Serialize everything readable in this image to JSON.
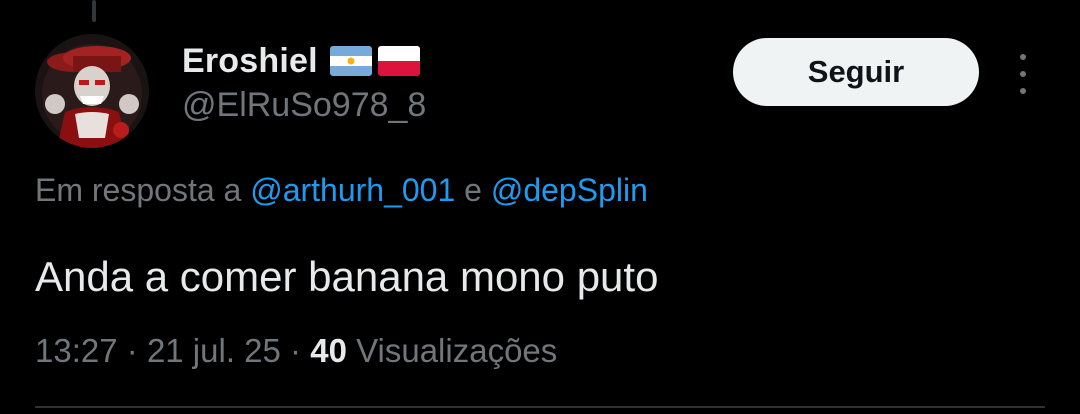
{
  "user": {
    "display_name": "Eroshiel",
    "handle": "@ElRuSo978_8",
    "flags": [
      "argentina-flag",
      "poland-flag"
    ]
  },
  "follow_button": {
    "label": "Seguir"
  },
  "reply_context": {
    "prefix": "Em resposta a",
    "mention_1": "@arthurh_001",
    "conjunction": "e",
    "mention_2": "@depSplin"
  },
  "tweet": {
    "text": "Anda a comer banana mono puto"
  },
  "meta": {
    "time": "13:27",
    "separator": "·",
    "date": "21 jul. 25",
    "views_count": "40",
    "views_label": "Visualizações"
  },
  "colors": {
    "background": "#000000",
    "text_primary": "#e7e9ea",
    "text_secondary": "#71767b",
    "link": "#1d9bf0",
    "button_bg": "#eff3f4"
  }
}
